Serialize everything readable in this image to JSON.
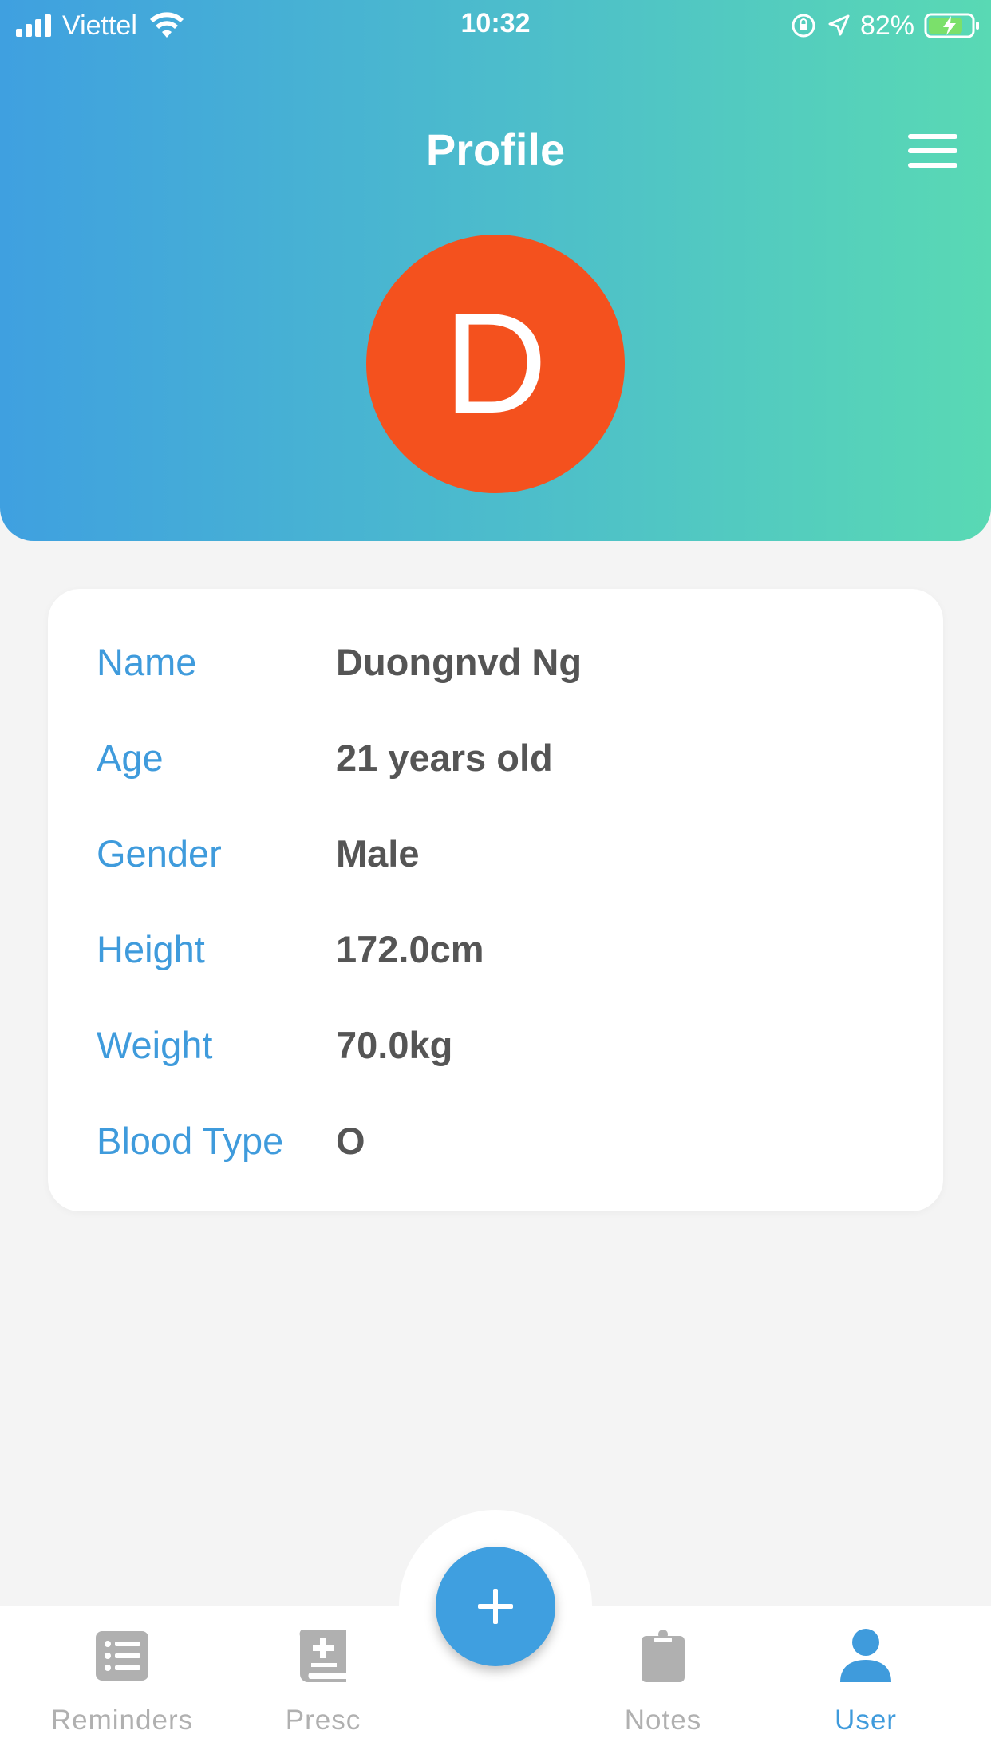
{
  "status_bar": {
    "carrier": "Viettel",
    "time": "10:32",
    "battery_percent": "82%"
  },
  "header": {
    "title": "Profile",
    "avatar_letter": "D",
    "avatar_color": "#f4511e",
    "gradient_start": "#3fa0e0",
    "gradient_end": "#59d9b4"
  },
  "profile": {
    "rows": [
      {
        "label": "Name",
        "value": "Duongnvd Ng"
      },
      {
        "label": "Age",
        "value": "21 years old"
      },
      {
        "label": "Gender",
        "value": "Male"
      },
      {
        "label": "Height",
        "value": "172.0cm"
      },
      {
        "label": "Weight",
        "value": "70.0kg"
      },
      {
        "label": "Blood Type",
        "value": "O"
      }
    ]
  },
  "bottom_nav": {
    "items": [
      {
        "label": "Reminders",
        "icon": "list-icon",
        "active": false
      },
      {
        "label": "Presc",
        "icon": "medical-book-icon",
        "active": false
      },
      {
        "label": "Notes",
        "icon": "clipboard-icon",
        "active": false
      },
      {
        "label": "User",
        "icon": "user-icon",
        "active": true
      }
    ],
    "fab_icon": "plus-icon",
    "accent_color": "#3f9fe0",
    "inactive_color": "#b0b0b0"
  }
}
